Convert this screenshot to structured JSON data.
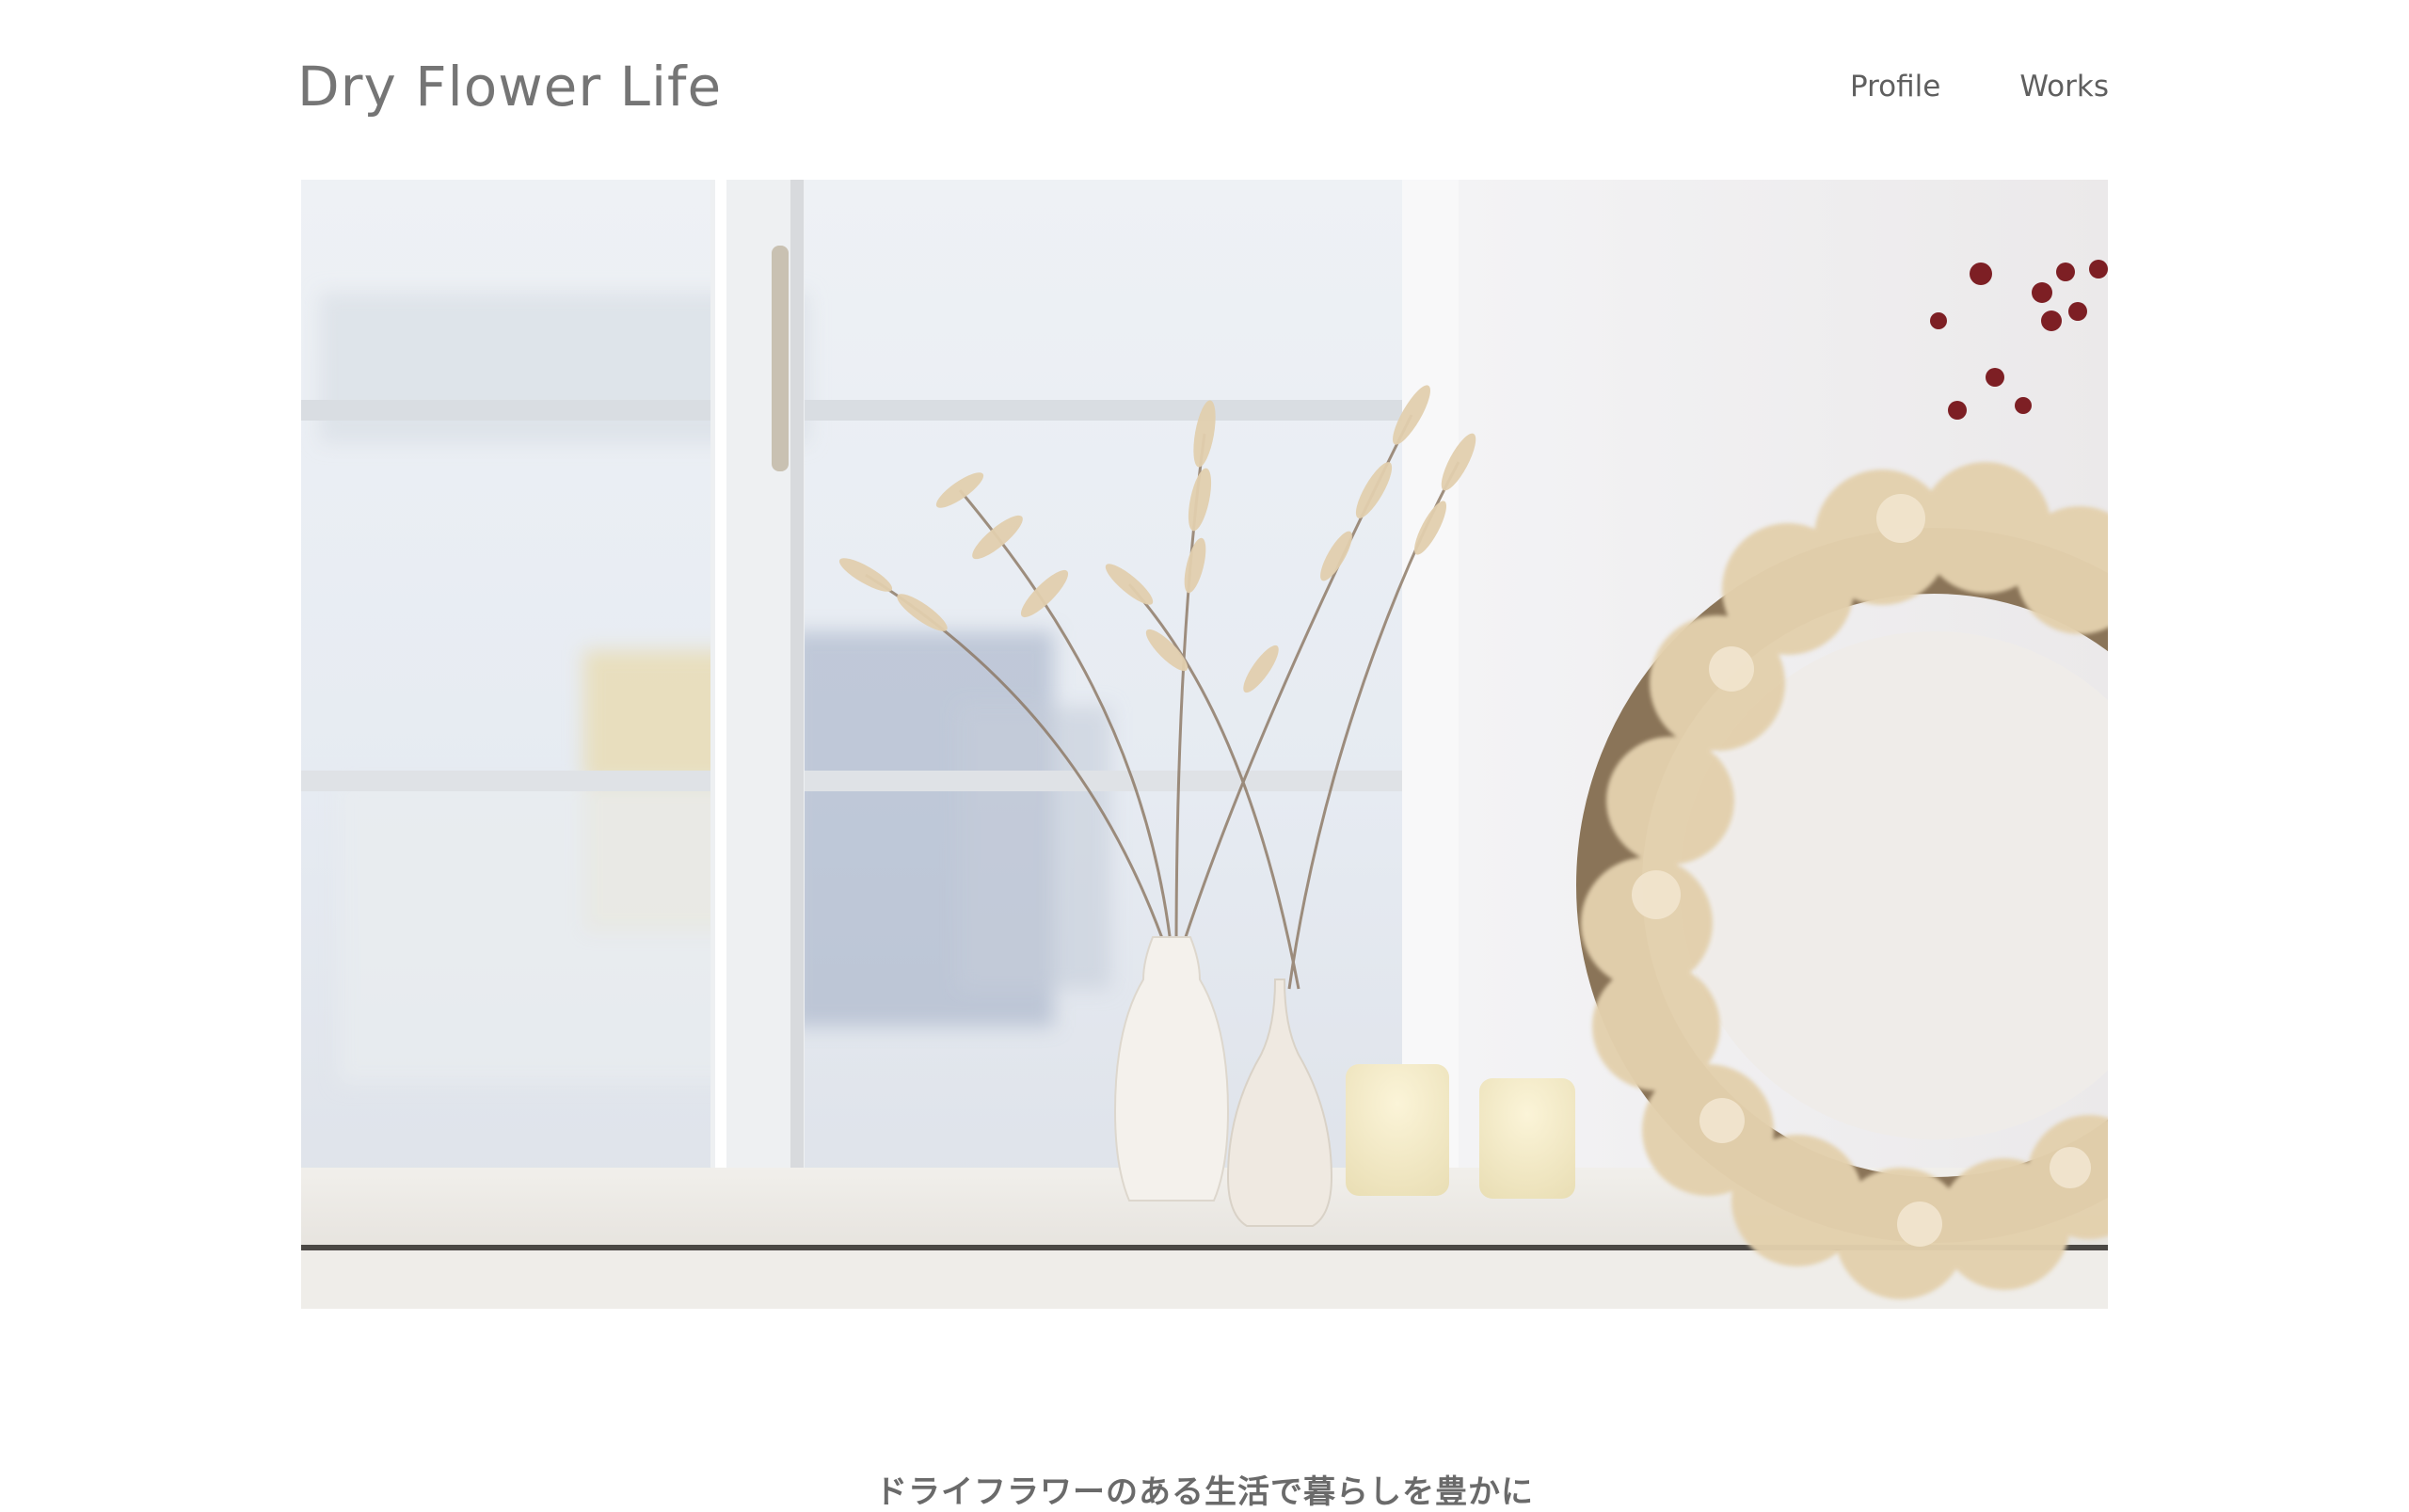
{
  "header": {
    "site_title": "Dry Flower Life",
    "nav": [
      {
        "label": "Profile"
      },
      {
        "label": "Works"
      }
    ]
  },
  "hero": {
    "image_name": "dried-flowers-by-window-photo"
  },
  "main": {
    "tagline": "ドライフラワーのある生活で暮らしを豊かに"
  },
  "colors": {
    "text": "#6b6b6b",
    "background": "#ffffff",
    "accent_beige": "#e2cfae"
  }
}
